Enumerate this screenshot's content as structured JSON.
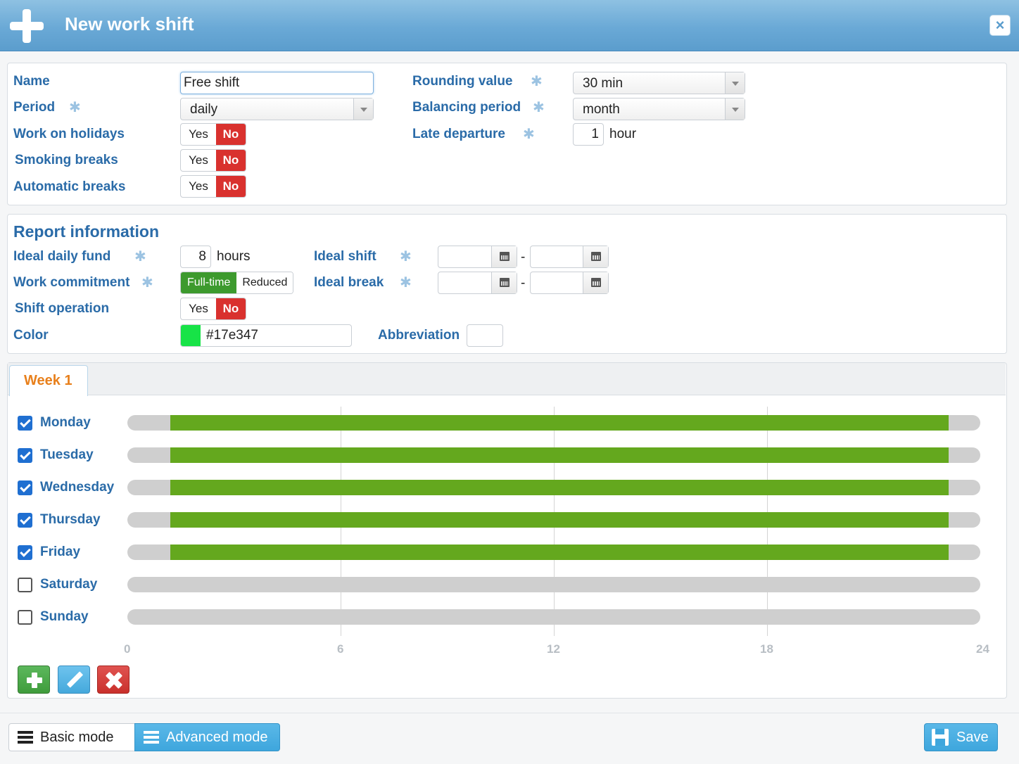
{
  "window": {
    "title": "New work shift",
    "close_label": "×"
  },
  "general": {
    "name_label": "Name",
    "name_value": "Free shift",
    "period_label": "Period",
    "period_value": "daily",
    "holidays_label": "Work on holidays",
    "smoking_label": "Smoking breaks",
    "auto_breaks_label": "Automatic breaks",
    "yes_label": "Yes",
    "no_label": "No",
    "rounding_label": "Rounding value",
    "rounding_value": "30 min",
    "balancing_label": "Balancing period",
    "balancing_value": "month",
    "late_label": "Late departure",
    "late_value": "1",
    "late_unit": "hour",
    "required_mark": "✱"
  },
  "report": {
    "title": "Report information",
    "daily_fund_label": "Ideal daily fund",
    "daily_fund_value": "8",
    "daily_fund_unit": "hours",
    "commitment_label": "Work commitment",
    "commitment_options": [
      "Full-time",
      "Reduced"
    ],
    "shift_op_label": "Shift operation",
    "ideal_shift_label": "Ideal shift",
    "ideal_break_label": "Ideal break",
    "range_sep": "-",
    "color_label": "Color",
    "color_value": "#17e347",
    "abbr_label": "Abbreviation",
    "abbr_value": ""
  },
  "schedule": {
    "tab_label": "Week 1",
    "axis_ticks": [
      "0",
      "6",
      "12",
      "18",
      "24"
    ],
    "axis_max_hours": 24,
    "bar_color": "#64a81e",
    "days": [
      {
        "label": "Monday",
        "checked": true,
        "start": 1.2,
        "end": 23.1
      },
      {
        "label": "Tuesday",
        "checked": true,
        "start": 1.2,
        "end": 23.1
      },
      {
        "label": "Wednesday",
        "checked": true,
        "start": 1.2,
        "end": 23.1
      },
      {
        "label": "Thursday",
        "checked": true,
        "start": 1.2,
        "end": 23.1
      },
      {
        "label": "Friday",
        "checked": true,
        "start": 1.2,
        "end": 23.1
      },
      {
        "label": "Saturday",
        "checked": false,
        "start": null,
        "end": null
      },
      {
        "label": "Sunday",
        "checked": false,
        "start": null,
        "end": null
      }
    ]
  },
  "footer": {
    "basic_mode": "Basic mode",
    "advanced_mode": "Advanced mode",
    "save": "Save"
  }
}
